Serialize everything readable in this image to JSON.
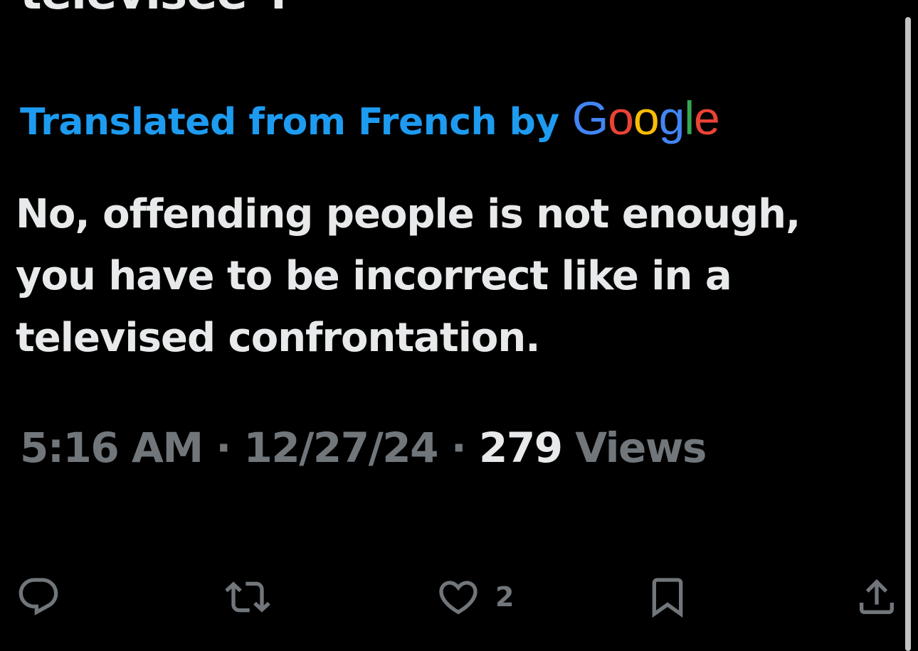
{
  "tweet": {
    "original_text_fragment": "télévisée\".",
    "translation_label": "Translated from French by",
    "translation_provider": "Google",
    "translated_text": "No, offending people is not enough, you have to be incorrect like in a televised confrontation.",
    "time": "5:16 AM",
    "date": "12/27/24",
    "views_count": "279",
    "views_label": "Views",
    "separator": "·"
  },
  "actions": {
    "reply_icon": "reply-icon",
    "retweet_icon": "retweet-icon",
    "like_icon": "heart-icon",
    "like_count": "2",
    "bookmark_icon": "bookmark-icon",
    "share_icon": "share-icon"
  },
  "colors": {
    "background": "#000000",
    "text_primary": "#e7e9ea",
    "text_secondary": "#71767b",
    "accent": "#1d9bf0",
    "google_blue": "#4285f4",
    "google_red": "#ea4335",
    "google_yellow": "#fbbc05",
    "google_green": "#34a853"
  }
}
